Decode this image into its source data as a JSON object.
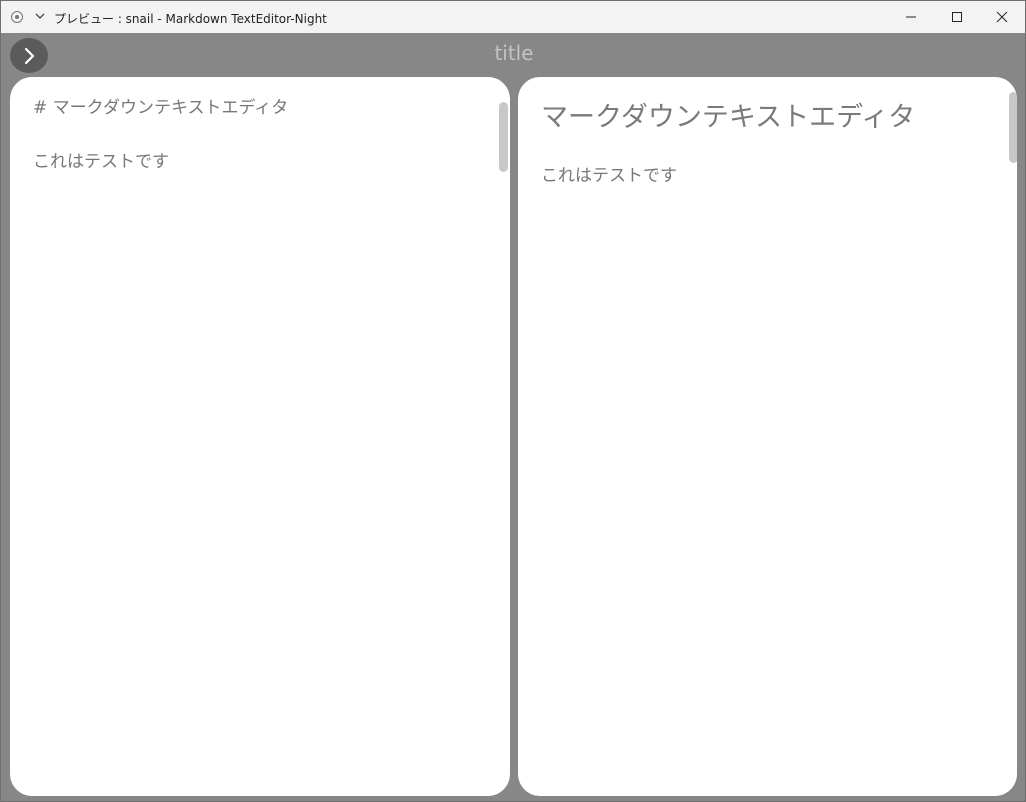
{
  "window": {
    "title": "プレビュー : snail - Markdown TextEditor-Night",
    "icon": "app-circle-icon",
    "controls": {
      "minimize_icon": "minimize-icon",
      "maximize_icon": "maximize-icon",
      "close_icon": "close-icon"
    }
  },
  "toolbar": {
    "toggle_icon": "chevron-right-icon",
    "title": "title"
  },
  "editor": {
    "line1": "# マークダウンテキストエディタ",
    "line2": "",
    "line3": "これはテストです"
  },
  "preview": {
    "heading": "マークダウンテキストエディタ",
    "paragraph": "これはテストです"
  },
  "colors": {
    "background": "#878787",
    "pane": "#ffffff",
    "titlebar": "#f3f3f3",
    "toggle_button": "#5b5b5b",
    "title_text": "#c3c3c3",
    "text": "#777777"
  }
}
